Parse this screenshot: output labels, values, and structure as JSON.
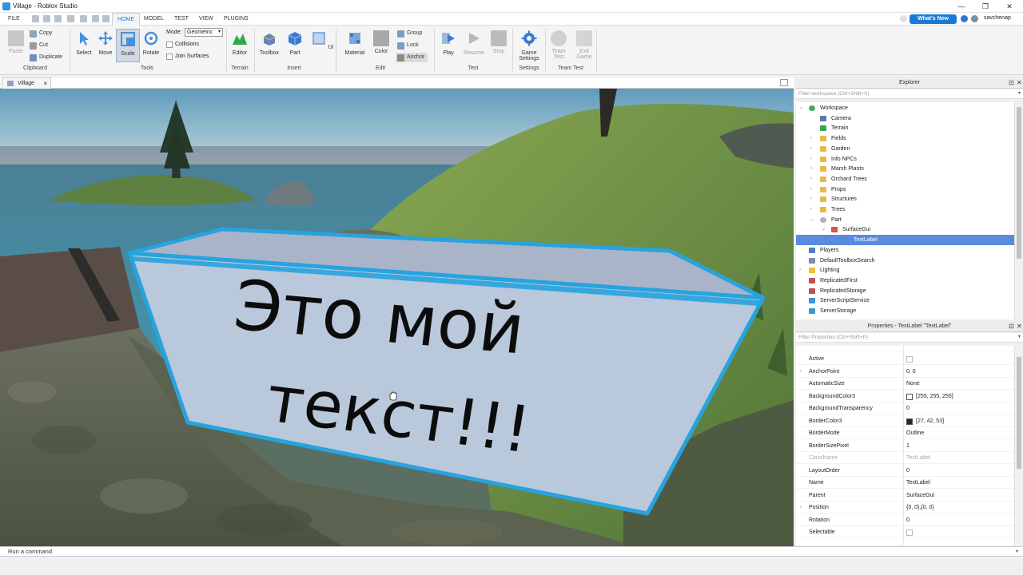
{
  "window": {
    "title": "Village - Roblox Studio",
    "controls": [
      "—",
      "❐",
      "✕"
    ]
  },
  "menu": {
    "tabs": [
      "FILE",
      "HOME",
      "MODEL",
      "TEST",
      "VIEW",
      "PLUGINS"
    ],
    "active_tab": "HOME",
    "whats_new": "What's New",
    "username": "savchenap"
  },
  "ribbon": {
    "clipboard": {
      "paste": "Paste",
      "copy": "Copy",
      "cut": "Cut",
      "duplicate": "Duplicate",
      "label": "Clipboard"
    },
    "tools": {
      "select": "Select",
      "move": "Move",
      "scale": "Scale",
      "rotate": "Rotate",
      "mode_label": "Mode:",
      "mode_value": "Geometric",
      "collisions": "Collisions",
      "join_surfaces": "Join Surfaces",
      "label": "Tools"
    },
    "terrain": {
      "editor": "Editor",
      "label": "Terrain"
    },
    "insert": {
      "toolbox": "Toolbox",
      "part": "Part",
      "ui": "UI",
      "label": "Insert"
    },
    "edit": {
      "material": "Material",
      "color": "Color",
      "group": "Group",
      "lock": "Lock",
      "anchor": "Anchor",
      "label": "Edit"
    },
    "test": {
      "play": "Play",
      "resume": "Resume",
      "stop": "Stop",
      "label": "Test"
    },
    "settings": {
      "game_settings_1": "Game",
      "game_settings_2": "Settings",
      "label": "Settings"
    },
    "team_test": {
      "team_1": "Team",
      "team_2": "Test",
      "exit_1": "Exit",
      "exit_2": "Game",
      "label": "Team Test"
    }
  },
  "viewport": {
    "tab": "Village",
    "sign_line_1": "Это мой",
    "sign_line_2": "текст!!!"
  },
  "explorer": {
    "title": "Explorer",
    "filter_placeholder": "Filter workspace (Ctrl+Shift+X)",
    "items": [
      {
        "label": "Workspace",
        "depth": 0,
        "expand": "⌄",
        "icon": "globe-icon",
        "color": "#3fb04a"
      },
      {
        "label": "Camera",
        "depth": 1,
        "expand": "",
        "icon": "camera-icon",
        "color": "#5a7ea8"
      },
      {
        "label": "Terrain",
        "depth": 1,
        "expand": "",
        "icon": "terrain-icon",
        "color": "#2fa84f"
      },
      {
        "label": "Fields",
        "depth": 1,
        "expand": "›",
        "icon": "folder-icon",
        "color": "#e8b84a"
      },
      {
        "label": "Garden",
        "depth": 1,
        "expand": "›",
        "icon": "folder-icon",
        "color": "#e8b84a"
      },
      {
        "label": "Info NPCs",
        "depth": 1,
        "expand": "›",
        "icon": "folder-icon",
        "color": "#e8b84a"
      },
      {
        "label": "Marsh Plants",
        "depth": 1,
        "expand": "›",
        "icon": "folder-icon",
        "color": "#e8b84a"
      },
      {
        "label": "Orchard Trees",
        "depth": 1,
        "expand": "›",
        "icon": "folder-icon",
        "color": "#e8b84a"
      },
      {
        "label": "Props",
        "depth": 1,
        "expand": "›",
        "icon": "folder-icon",
        "color": "#e8b84a"
      },
      {
        "label": "Structures",
        "depth": 1,
        "expand": "›",
        "icon": "folder-icon",
        "color": "#e8b84a"
      },
      {
        "label": "Trees",
        "depth": 1,
        "expand": "›",
        "icon": "folder-icon",
        "color": "#e8b84a"
      },
      {
        "label": "Part",
        "depth": 1,
        "expand": "⌄",
        "icon": "part-icon",
        "color": "#b0b0b0"
      },
      {
        "label": "SurfaceGui",
        "depth": 2,
        "expand": "⌄",
        "icon": "surfacegui-icon",
        "color": "#d9534f"
      },
      {
        "label": "TextLabel",
        "depth": 3,
        "expand": "",
        "icon": "textlabel-icon",
        "color": "#4a8fd9",
        "selected": true
      },
      {
        "label": "Players",
        "depth": 0,
        "expand": "",
        "icon": "players-icon",
        "color": "#4a7fc0"
      },
      {
        "label": "DefaultToolboxSearch",
        "depth": 0,
        "expand": "",
        "icon": "search-icon",
        "color": "#7a8ea8"
      },
      {
        "label": "Lighting",
        "depth": 0,
        "expand": "›",
        "icon": "lighting-icon",
        "color": "#f0c030"
      },
      {
        "label": "ReplicatedFirst",
        "depth": 0,
        "expand": "",
        "icon": "replicated-icon",
        "color": "#c05050"
      },
      {
        "label": "ReplicatedStorage",
        "depth": 0,
        "expand": "",
        "icon": "storage-icon",
        "color": "#c05050"
      },
      {
        "label": "ServerScriptService",
        "depth": 0,
        "expand": "",
        "icon": "script-service-icon",
        "color": "#3a9ad0"
      },
      {
        "label": "ServerStorage",
        "depth": 0,
        "expand": "",
        "icon": "server-storage-icon",
        "color": "#3a9ad0"
      }
    ]
  },
  "properties": {
    "title": "Properties - TextLabel \"TextLabel\"",
    "filter_placeholder": "Filter Properties (Ctrl+Shift+P)",
    "rows": [
      {
        "name": "Active",
        "value": "",
        "type": "checkbox"
      },
      {
        "name": "AnchorPoint",
        "value": "0, 0",
        "type": "expand"
      },
      {
        "name": "AutomaticSize",
        "value": "None",
        "type": "text"
      },
      {
        "name": "BackgroundColor3",
        "value": "[255, 255, 255]",
        "type": "color",
        "swatch": "#ffffff"
      },
      {
        "name": "BackgroundTransparency",
        "value": "0",
        "type": "text"
      },
      {
        "name": "BorderColor3",
        "value": "[27, 42, 53]",
        "type": "color",
        "swatch": "#1b2a35"
      },
      {
        "name": "BorderMode",
        "value": "Outline",
        "type": "text"
      },
      {
        "name": "BorderSizePixel",
        "value": "1",
        "type": "text"
      },
      {
        "name": "ClassName",
        "value": "TextLabel",
        "type": "dim"
      },
      {
        "name": "LayoutOrder",
        "value": "0",
        "type": "text"
      },
      {
        "name": "Name",
        "value": "TextLabel",
        "type": "text"
      },
      {
        "name": "Parent",
        "value": "SurfaceGui",
        "type": "text"
      },
      {
        "name": "Position",
        "value": "{0, 0},{0, 0}",
        "type": "expand"
      },
      {
        "name": "Rotation",
        "value": "0",
        "type": "text"
      },
      {
        "name": "Selectable",
        "value": "",
        "type": "checkbox"
      }
    ]
  },
  "command_bar": {
    "placeholder": "Run a command"
  }
}
